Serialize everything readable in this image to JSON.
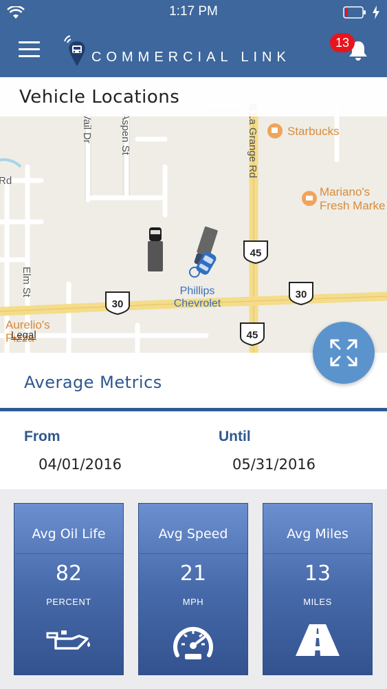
{
  "status_bar": {
    "time": "1:17 PM"
  },
  "header": {
    "brand": "COMMERCIAL LINK",
    "notification_count": "13"
  },
  "map": {
    "title": "Vehicle Locations",
    "legal": "Legal",
    "streets": [
      "Vail Dr",
      "Aspen St",
      "S La Grange Rd",
      "Elm St",
      "Rd"
    ],
    "route_shields": [
      "45",
      "30",
      "30",
      "45"
    ],
    "places": [
      "Starbucks",
      "Mariano's",
      "Fresh Marke",
      "Aurelio's",
      "Pizza"
    ],
    "dealer": [
      "Phillips",
      "Chevrolet"
    ]
  },
  "metrics": {
    "title": "Average Metrics",
    "from_label": "From",
    "from_value": "04/01/2016",
    "until_label": "Until",
    "until_value": "05/31/2016",
    "cards": [
      {
        "title": "Avg Oil Life",
        "value": "82",
        "unit": "PERCENT",
        "icon": "oil-can-icon"
      },
      {
        "title": "Avg Speed",
        "value": "21",
        "unit": "MPH",
        "icon": "speedometer-icon"
      },
      {
        "title": "Avg Miles",
        "value": "13",
        "unit": "MILES",
        "icon": "road-icon"
      }
    ]
  },
  "colors": {
    "header": "#3d679d",
    "accent": "#2e578e",
    "card": "#476aaa",
    "badge": "#e8141c",
    "fab": "#5b93cd"
  }
}
